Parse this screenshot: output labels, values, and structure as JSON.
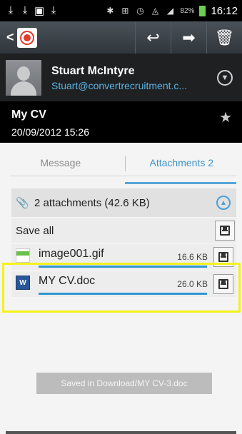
{
  "status_bar": {
    "notifications": [
      "download",
      "download",
      "image",
      "download"
    ],
    "system_icons": [
      "bluetooth-icon",
      "nfc-icon",
      "alarm-icon",
      "wifi-icon",
      "signal-icon"
    ],
    "battery": "82%",
    "time": "16:12"
  },
  "action_bar": {
    "back_symbol": "<",
    "actions": [
      "reply-icon",
      "forward-icon",
      "delete-icon"
    ]
  },
  "sender": {
    "name": "Stuart McIntyre",
    "email": "Stuart@convertrecruitment.c..."
  },
  "message": {
    "subject": "My CV",
    "date": "20/09/2012 15:26"
  },
  "tabs": {
    "message": "Message",
    "attachments": "Attachments 2"
  },
  "attachments": {
    "summary": "2 attachments (42.6 KB)",
    "save_all": "Save all",
    "items": [
      {
        "name": "image001.gif",
        "size": "16.6 KB",
        "progress": 1.0
      },
      {
        "name": "MY CV.doc",
        "size": "26.0 KB",
        "progress": 1.0
      }
    ]
  },
  "toast": "Saved in Download/MY CV-3.doc",
  "colors": {
    "accent": "#3d94c9",
    "highlight": "#f5f219",
    "progress": "#3197d2"
  }
}
